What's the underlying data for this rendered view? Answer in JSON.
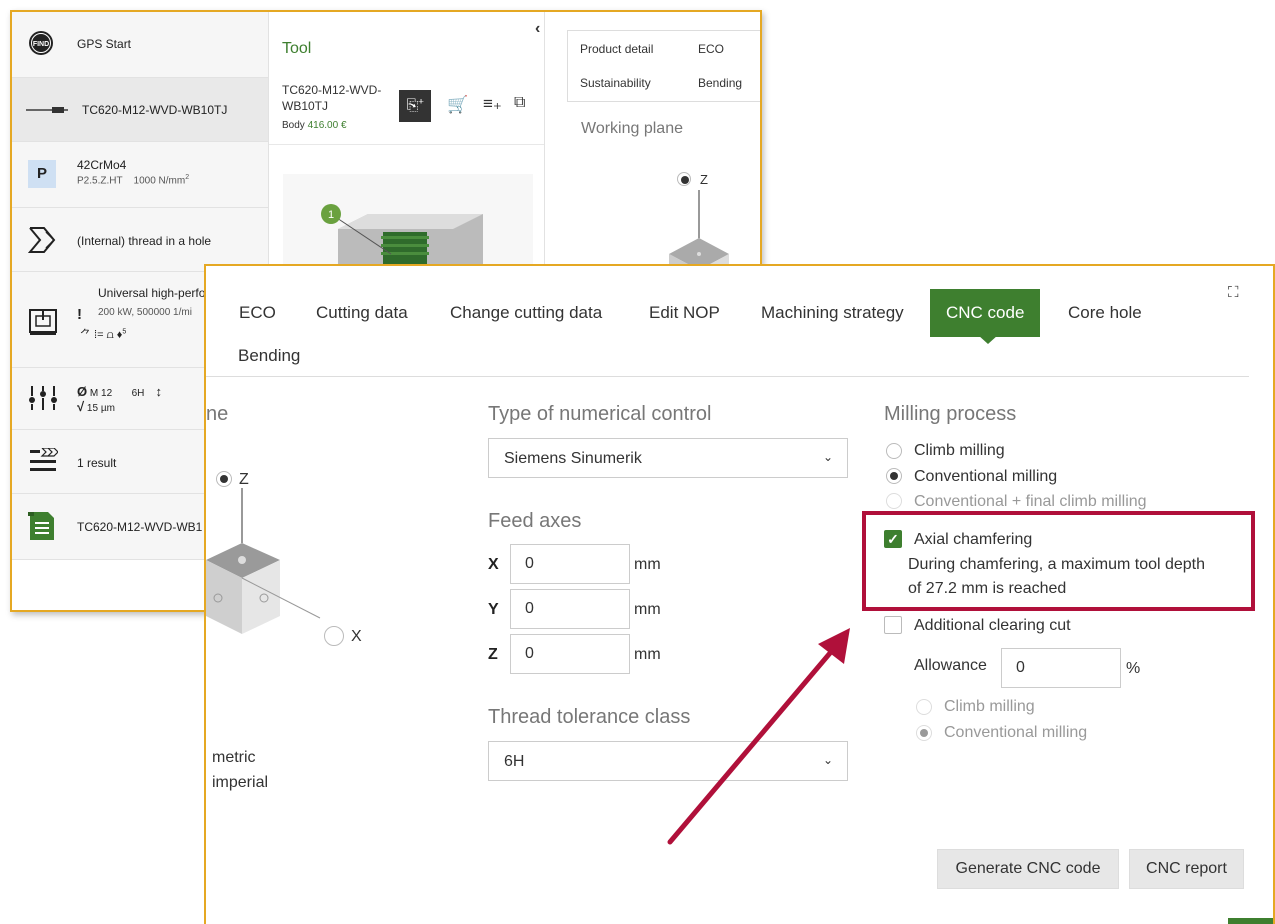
{
  "sidebar": {
    "gps_start": "GPS Start",
    "tool_item": "TC620-M12-WVD-WB10TJ",
    "material_badge": "P",
    "material_name": "42CrMo4",
    "material_code": "P2.5.Z.HT",
    "material_strength": "1000 N/mm",
    "material_strength_sup": "2",
    "operation": "(Internal) thread in a hole",
    "machine_name": "Universal high-perfo",
    "machine_specs": "200 kW, 500000 1/mi",
    "machine_icons": "⺈ ⁞= ⩍ ♦",
    "machine_icons_sup": "5",
    "thread_size": "M 12",
    "thread_tolerance": "6H",
    "thread_roughness": "15 µm",
    "results": "1 result",
    "result_item": "TC620-M12-WVD-WB1"
  },
  "tool": {
    "heading": "Tool",
    "name_line1": "TC620-M12-WVD-",
    "name_line2": "WB10TJ",
    "price_label": "Body",
    "price_value": "416.00 €",
    "marker": "1"
  },
  "detail": {
    "tabs": [
      "Product detail",
      "ECO",
      "Sustainability",
      "Bending"
    ],
    "working_plane": "Working plane",
    "axis_z": "Z"
  },
  "dialog": {
    "tabs": [
      "ECO",
      "Cutting data",
      "Change cutting data",
      "Edit NOP",
      "Machining strategy",
      "CNC code",
      "Core hole",
      "Bending"
    ],
    "active_tab": "CNC code",
    "left_heading_fragment": "ne",
    "axis_z": "Z",
    "axis_x": "X",
    "unit_metric": "metric",
    "unit_imperial": "imperial",
    "nc_heading": "Type of numerical control",
    "nc_value": "Siemens Sinumerik",
    "feed_heading": "Feed axes",
    "feed_axes": [
      {
        "axis": "X",
        "value": "0",
        "unit": "mm"
      },
      {
        "axis": "Y",
        "value": "0",
        "unit": "mm"
      },
      {
        "axis": "Z",
        "value": "0",
        "unit": "mm"
      }
    ],
    "tolerance_heading": "Thread tolerance class",
    "tolerance_value": "6H",
    "milling_heading": "Milling process",
    "milling_options": [
      "Climb milling",
      "Conventional milling",
      "Conventional + final climb milling"
    ],
    "milling_selected": "Conventional milling",
    "axial_chamfering_label": "Axial chamfering",
    "axial_chamfering_checked": true,
    "axial_chamfering_note_1": "During chamfering, a maximum tool depth",
    "axial_chamfering_note_2": "of 27.2 mm is reached",
    "clearing_cut_label": "Additional clearing cut",
    "clearing_cut_checked": false,
    "allowance_label": "Allowance",
    "allowance_value": "0",
    "allowance_unit": "%",
    "sub_options": [
      "Climb milling",
      "Conventional milling"
    ],
    "generate_button": "Generate CNC code",
    "report_button": "CNC report"
  },
  "colors": {
    "accent_green": "#3e7f2f",
    "frame_orange": "#e5a823",
    "highlight_red": "#b0103a"
  }
}
